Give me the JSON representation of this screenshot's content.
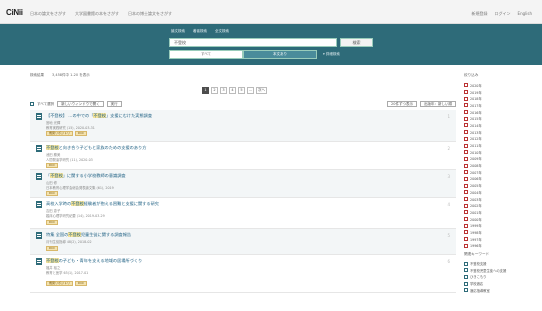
{
  "header": {
    "logo_ci": "CiNii",
    "links": [
      "日本の論文をさがす",
      "大学図書館の本をさがす",
      "日本の博士論文をさがす"
    ],
    "right": [
      "新規登録",
      "ログイン",
      "English"
    ]
  },
  "search": {
    "tabs": [
      "論文検索",
      "著者検索",
      "全文検索"
    ],
    "query": "不登校",
    "button": "検索",
    "mode_all": "すべて",
    "mode_fulltext": "本文あり",
    "advanced": "詳細検索"
  },
  "results": {
    "count_text": "検索結果",
    "count_value": "3,458件中 1-20 を表示",
    "pages": [
      "1",
      "2",
      "3",
      "4",
      "5",
      "..."
    ],
    "next": "次へ",
    "select_all": "すべて選択",
    "export_label": "新しいウィンドウで開く",
    "export_button": "実行",
    "sort_label": "20件ずつ表示",
    "order_label": "出版年：新しい順"
  },
  "items": [
    {
      "title_pre": "【不登校】 …の中での「",
      "title_mark": "不登校",
      "title_post": "」支援にむけた実態調査",
      "authors": "宮地 光輝",
      "meta": "教育実践研究 (15), 2020-03-31",
      "tags": [
        "機関リポジトリ",
        "DOI"
      ],
      "number": "1"
    },
    {
      "title_pre": "",
      "title_mark": "不登校",
      "title_post": "と向き合う子どもと家族のための支援のあり方",
      "authors": "池田 勝美",
      "meta": "人間発達学研究 (11), 2020-03",
      "tags": [
        "DOI"
      ],
      "number": "2"
    },
    {
      "title_pre": "「",
      "title_mark": "不登校",
      "title_post": "」に関する小学校教師の意識調査",
      "authors": "山田 修",
      "meta": "日本教育心理学会総会発表論文集 (61), 2019",
      "tags": [
        "DOI"
      ],
      "number": "3"
    },
    {
      "title_pre": "高校入学時の",
      "title_mark": "不登校",
      "title_post": "経験者が抱える困難と支援に関する研究",
      "authors": "吉田 恵子",
      "meta": "臨床心理学研究紀要 (14), 2019-03-29",
      "tags": [
        "DOI"
      ],
      "number": "4"
    },
    {
      "title_pre": "特集 全国の",
      "title_mark": "不登校",
      "title_post": "児童生徒に関する調査報告",
      "authors": "",
      "meta": "月刊生徒指導 48(2), 2018-02",
      "tags": [
        "DOI"
      ],
      "number": "5"
    },
    {
      "title_pre": "",
      "title_mark": "不登校",
      "title_post": "の子ども・青年を支える地域の居場所づくり",
      "authors": "福井 裕之",
      "meta": "教育と医学 65(1), 2017-01",
      "tags": [
        "機関リポジトリ",
        "DOI"
      ],
      "number": "6"
    }
  ],
  "sidebar": {
    "facet_title": "絞り込み",
    "facets": [
      "2020年",
      "2019年",
      "2018年",
      "2017年",
      "2016年",
      "2015年",
      "2014年",
      "2013年",
      "2012年",
      "2011年",
      "2010年",
      "2009年",
      "2008年",
      "2007年",
      "2006年",
      "2005年",
      "2004年",
      "2003年",
      "2002年",
      "2001年",
      "2000年",
      "1999年",
      "1998年",
      "1997年",
      "1996年"
    ],
    "related_title": "関連キーワード",
    "related": [
      "不登校支援",
      "不登校児童生徒への支援",
      "ひきこもり",
      "学校適応",
      "適応指導教室"
    ]
  }
}
